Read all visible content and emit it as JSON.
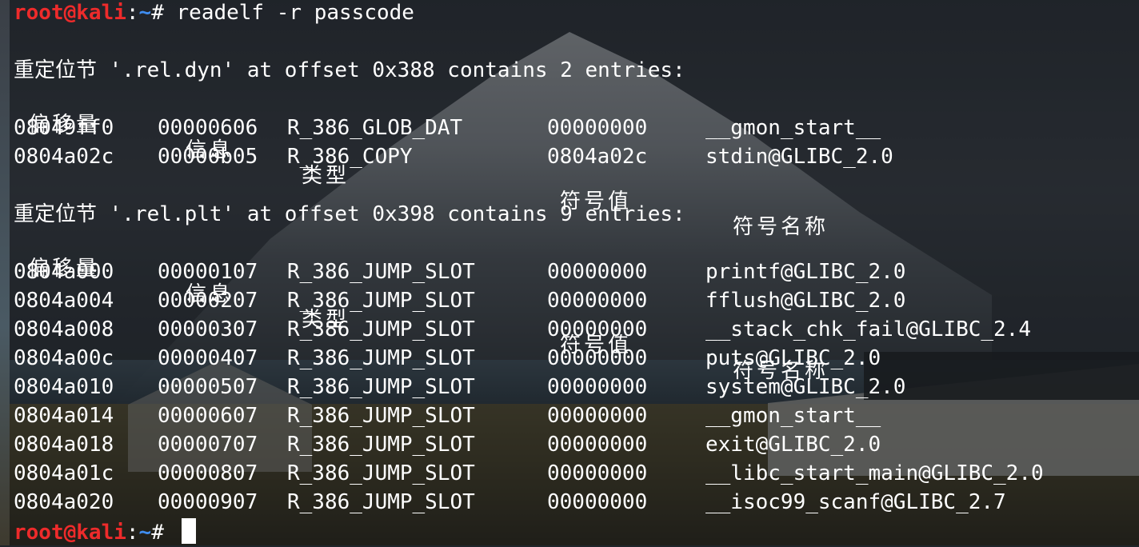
{
  "prompt": {
    "user_host": "root@kali",
    "sep": ":",
    "path": "~",
    "symbol": "#"
  },
  "command": "readelf -r passcode",
  "sections": [
    {
      "heading": "重定位节 '.rel.dyn' at offset 0x388 contains 2 entries:",
      "columns": [
        "偏移量",
        "信息",
        "类型",
        "符号值",
        "符号名称"
      ],
      "rows": [
        {
          "offset": "08049ff0",
          "info": "00000606",
          "type": "R_386_GLOB_DAT",
          "sym_value": "00000000",
          "sym_name": "__gmon_start__"
        },
        {
          "offset": "0804a02c",
          "info": "00000b05",
          "type": "R_386_COPY",
          "sym_value": "0804a02c",
          "sym_name": "stdin@GLIBC_2.0"
        }
      ]
    },
    {
      "heading": "重定位节 '.rel.plt' at offset 0x398 contains 9 entries:",
      "columns": [
        "偏移量",
        "信息",
        "类型",
        "符号值",
        "符号名称"
      ],
      "rows": [
        {
          "offset": "0804a000",
          "info": "00000107",
          "type": "R_386_JUMP_SLOT",
          "sym_value": "00000000",
          "sym_name": "printf@GLIBC_2.0"
        },
        {
          "offset": "0804a004",
          "info": "00000207",
          "type": "R_386_JUMP_SLOT",
          "sym_value": "00000000",
          "sym_name": "fflush@GLIBC_2.0"
        },
        {
          "offset": "0804a008",
          "info": "00000307",
          "type": "R_386_JUMP_SLOT",
          "sym_value": "00000000",
          "sym_name": "__stack_chk_fail@GLIBC_2.4"
        },
        {
          "offset": "0804a00c",
          "info": "00000407",
          "type": "R_386_JUMP_SLOT",
          "sym_value": "00000000",
          "sym_name": "puts@GLIBC_2.0"
        },
        {
          "offset": "0804a010",
          "info": "00000507",
          "type": "R_386_JUMP_SLOT",
          "sym_value": "00000000",
          "sym_name": "system@GLIBC_2.0"
        },
        {
          "offset": "0804a014",
          "info": "00000607",
          "type": "R_386_JUMP_SLOT",
          "sym_value": "00000000",
          "sym_name": "__gmon_start__"
        },
        {
          "offset": "0804a018",
          "info": "00000707",
          "type": "R_386_JUMP_SLOT",
          "sym_value": "00000000",
          "sym_name": "exit@GLIBC_2.0"
        },
        {
          "offset": "0804a01c",
          "info": "00000807",
          "type": "R_386_JUMP_SLOT",
          "sym_value": "00000000",
          "sym_name": "__libc_start_main@GLIBC_2.0"
        },
        {
          "offset": "0804a020",
          "info": "00000907",
          "type": "R_386_JUMP_SLOT",
          "sym_value": "00000000",
          "sym_name": "__isoc99_scanf@GLIBC_2.7"
        }
      ]
    }
  ],
  "colors": {
    "prompt_user": "#ee2b2b",
    "prompt_path": "#3f8df0",
    "text": "#ffffff"
  }
}
